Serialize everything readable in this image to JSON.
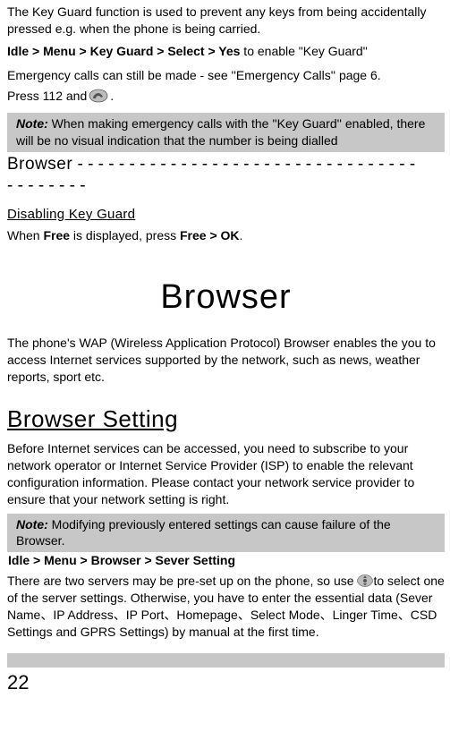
{
  "intro": {
    "line1": "The Key Guard function is used to prevent any keys from being accidentally pressed e.g. when the phone is being carried.",
    "nav": "Idle > Menu > Key Guard > Select > Yes",
    "nav_suffix": " to enable \"Key Guard\"",
    "emergency": "Emergency calls can still be made - see ''Emergency Calls'' page 6.",
    "press_prefix": "Press 112 and",
    "press_suffix": "."
  },
  "note1": {
    "label": "Note:",
    "text": " When making emergency calls with the ''Key Guard''  enabled, there will be no visual indication that the number is being dialled"
  },
  "browser_dash": {
    "word": "Browser",
    "dashes1": " - - - - - - - - - - - - - - - - - - - - - - - - - - - - - - - - -",
    "dashes2": "- - - - - - - -"
  },
  "disable": {
    "head": "Disabling Key Guard",
    "text_prefix": "When ",
    "free": "Free",
    "text_mid": " is displayed, press ",
    "freeok": "Free > OK",
    "text_suffix": "."
  },
  "browser_title": "Browser",
  "wap_para": "The phone's WAP (Wireless Application Protocol) Browser enables the you to access Internet services supported by the network, such as news, weather reports, sport etc.",
  "setting_head": "Browser Setting",
  "setting_para": "Before Internet services can be accessed, you need to subscribe to your network operator or Internet Service Provider (ISP) to enable the relevant configuration information. Please contact your network service provider to ensure that your network setting is right.",
  "note2": {
    "label": "Note:",
    "text": " Modifying previously entered settings can cause failure of the Browser."
  },
  "nav2": " Idle > Menu > Browser > Sever Setting",
  "servers": {
    "p1": "There are two servers may be pre-set up on the phone, so use ",
    "p2": "to select one of the server settings. Otherwise, you have to enter the essential data (Sever Name、IP Address、IP Port、Homepage、Select Mode、Linger Time、CSD Settings and GPRS Settings) by manual at the first time."
  },
  "page_number": "22"
}
